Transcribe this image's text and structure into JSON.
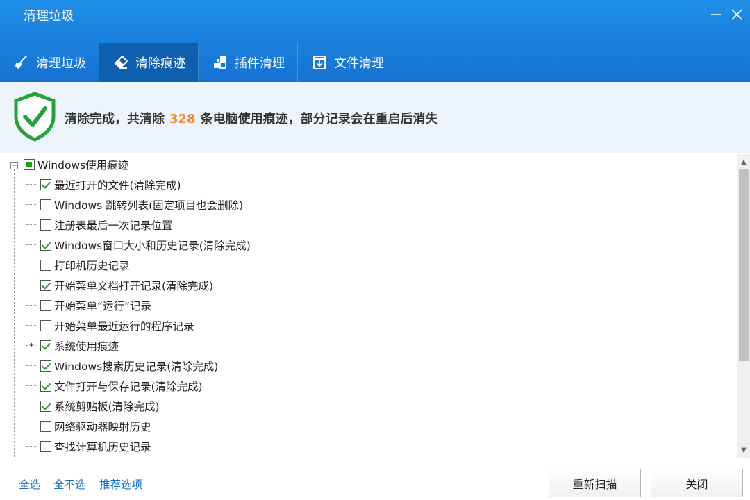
{
  "window": {
    "title": "清理垃圾"
  },
  "tabs": [
    {
      "label": "清理垃圾",
      "icon": "broom-icon",
      "active": false
    },
    {
      "label": "清除痕迹",
      "icon": "eraser-icon",
      "active": true
    },
    {
      "label": "插件清理",
      "icon": "plugin-icon",
      "active": false
    },
    {
      "label": "文件清理",
      "icon": "file-download-icon",
      "active": false
    }
  ],
  "status": {
    "prefix": "清除完成，共清除",
    "count": "328",
    "suffix": "条电脑使用痕迹，部分记录会在重启后消失",
    "count_color": "#f08a24"
  },
  "tree": {
    "root_label": "Windows使用痕迹",
    "items": [
      {
        "label": "最近打开的文件(清除完成)",
        "checked": true
      },
      {
        "label": "Windows 跳转列表(固定项目也会删除)",
        "checked": false
      },
      {
        "label": "注册表最后一次记录位置",
        "checked": false
      },
      {
        "label": "Windows窗口大小和历史记录(清除完成)",
        "checked": true
      },
      {
        "label": "打印机历史记录",
        "checked": false
      },
      {
        "label": "开始菜单文档打开记录(清除完成)",
        "checked": true
      },
      {
        "label": "开始菜单“运行”记录",
        "checked": false
      },
      {
        "label": "开始菜单最近运行的程序记录",
        "checked": false
      },
      {
        "label": "系统使用痕迹",
        "checked": true,
        "expandable": true
      },
      {
        "label": "Windows搜索历史记录(清除完成)",
        "checked": true
      },
      {
        "label": "文件打开与保存记录(清除完成)",
        "checked": true
      },
      {
        "label": "系统剪贴板(清除完成)",
        "checked": true
      },
      {
        "label": "网络驱动器映射历史",
        "checked": false
      },
      {
        "label": "查找计算机历史记录",
        "checked": false
      }
    ]
  },
  "footer": {
    "select_all": "全选",
    "select_none": "全不选",
    "recommended": "推荐选项",
    "rescan": "重新扫描",
    "close": "关闭"
  },
  "colors": {
    "header": "#1672d2",
    "active_tab": "#0f5fb0",
    "link": "#1a6fc9",
    "check": "#2a9a2a"
  }
}
